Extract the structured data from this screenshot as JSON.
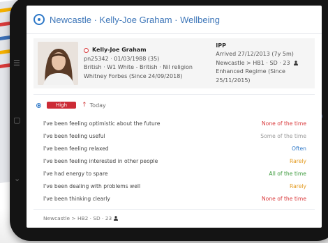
{
  "header": {
    "title": "Newcastle · Kelly-Joe Graham · Wellbeing"
  },
  "profile": {
    "name": "Kelly-Joe Graham",
    "id_dob": "pn25342 · 01/03/1988 (35)",
    "demographics": "British · W1 White - British · Nil religion",
    "keyworker": "Whitney Forbes (Since 24/09/2018)",
    "status": "IPP",
    "arrived": "Arrived 27/12/2013 (7y 5m)",
    "location": "Newcastle > HB1 · SD · 23",
    "regime": "Enhanced Regime (Since 25/11/2015)"
  },
  "priority": {
    "label": "High",
    "date": "Today"
  },
  "statements": [
    {
      "text": "I've been feeling optimistic about the future",
      "answer": "None of the time",
      "color": "#d9383a"
    },
    {
      "text": "I've been feeling useful",
      "answer": "Some of the time",
      "color": "#9a9a9a"
    },
    {
      "text": "I've been feeling relaxed",
      "answer": "Often",
      "color": "#2f79c8"
    },
    {
      "text": "I've been feeling interested in other people",
      "answer": "Rarely",
      "color": "#e39a1f"
    },
    {
      "text": "I've had energy to spare",
      "answer": "All of the time",
      "color": "#3c9a3c"
    },
    {
      "text": "I've been dealing with problems well",
      "answer": "Rarely",
      "color": "#e39a1f"
    },
    {
      "text": "I've been thinking clearly",
      "answer": "None of the time",
      "color": "#d9383a"
    }
  ],
  "footer": {
    "location": "Newcastle > HB2 · SD · 23"
  },
  "colors": {
    "accent": "#3f77b9",
    "high": "#cc2b36"
  }
}
